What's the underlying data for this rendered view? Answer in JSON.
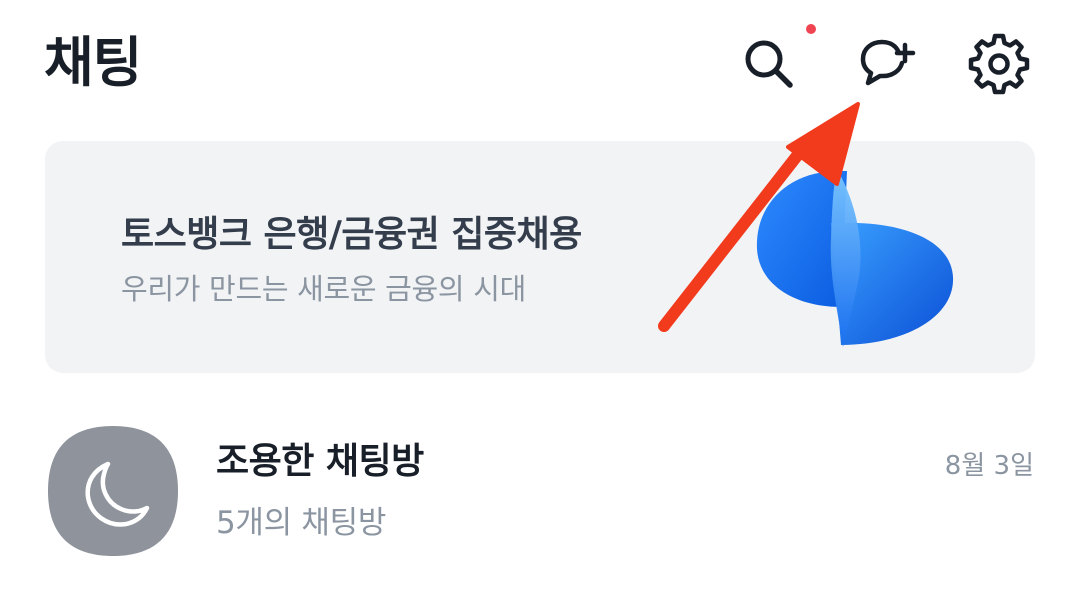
{
  "header": {
    "title": "채팅",
    "icons": {
      "search": "search-icon",
      "new_chat": "chat-plus-icon",
      "settings": "gear-icon"
    }
  },
  "banner": {
    "title": "토스뱅크 은행/금융권 집중채용",
    "subtitle": "우리가 만드는 새로운 금융의 시대",
    "art_icon": "toss-blue-logo"
  },
  "chat_list": [
    {
      "title": "조용한 채팅방",
      "subtitle": "5개의 채팅방",
      "date": "8월 3일",
      "avatar_icon": "moon-icon"
    }
  ],
  "colors": {
    "text_primary": "#191f28",
    "text_secondary": "#8b95a1",
    "banner_bg": "#f2f3f5",
    "notification_dot": "#f04452",
    "annotation_arrow": "#f23a1d",
    "avatar_bg": "#8e939c"
  }
}
